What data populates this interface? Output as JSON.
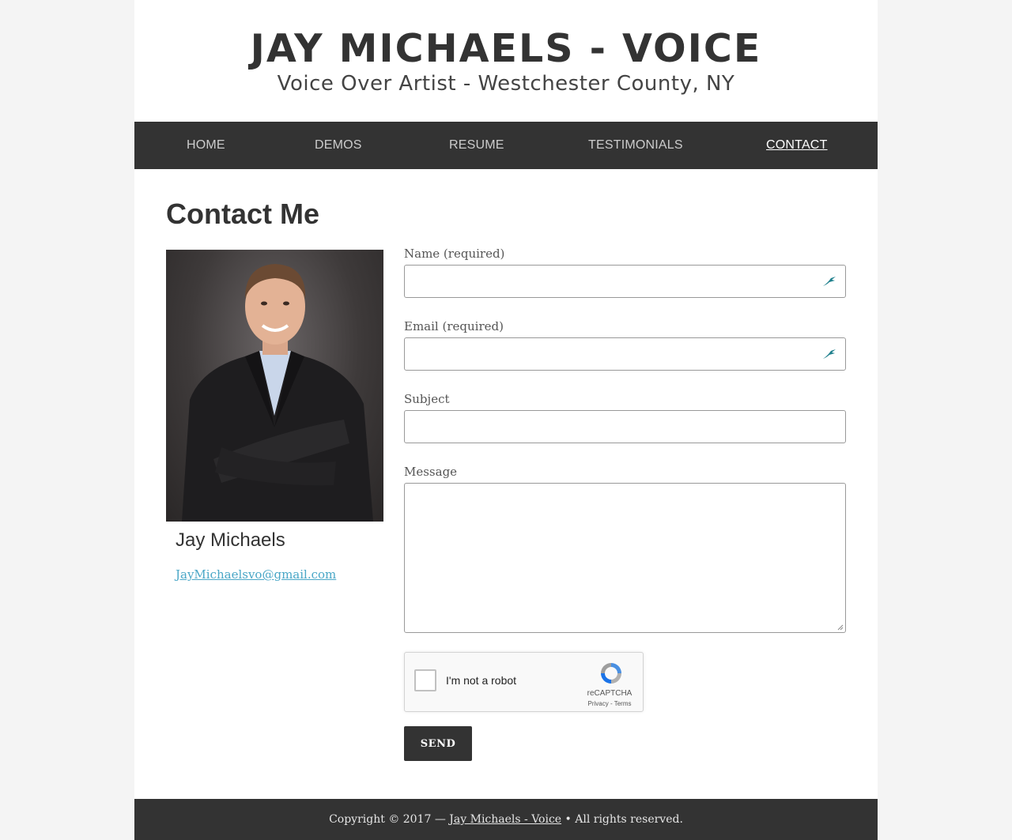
{
  "header": {
    "title": "JAY MICHAELS - VOICE",
    "tagline": "Voice Over Artist - Westchester County, NY"
  },
  "nav": {
    "items": [
      {
        "label": "HOME"
      },
      {
        "label": "DEMOS"
      },
      {
        "label": "RESUME"
      },
      {
        "label": "TESTIMONIALS"
      },
      {
        "label": "CONTACT",
        "active": true
      }
    ]
  },
  "main": {
    "title": "Contact Me",
    "profile": {
      "name": "Jay Michaels",
      "email": "JayMichaelsvo@gmail.com"
    },
    "form": {
      "name_label": "Name (required)",
      "name_value": "",
      "email_label": "Email (required)",
      "email_value": "",
      "subject_label": "Subject",
      "subject_value": "",
      "message_label": "Message",
      "message_value": "",
      "recaptcha": {
        "label": "I'm not a robot",
        "brand": "reCAPTCHA",
        "links": "Privacy - Terms"
      },
      "send_label": "SEND"
    }
  },
  "footer": {
    "prefix": "Copyright © 2017 —",
    "link_text": "Jay Michaels - Voice",
    "suffix": "• All rights reserved."
  },
  "colors": {
    "nav_bg": "#333333",
    "link": "#4aa7c7",
    "page_bg": "#f4f4f4"
  }
}
